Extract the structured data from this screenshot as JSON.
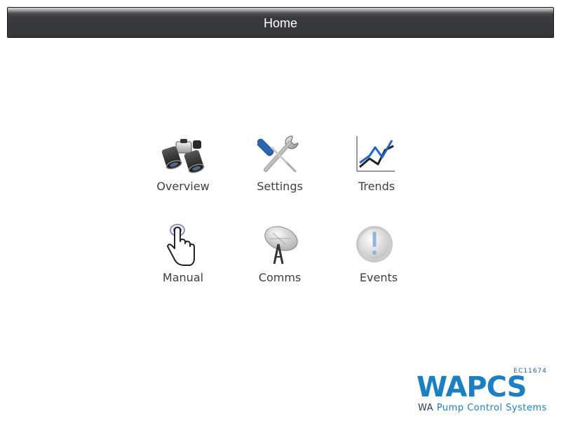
{
  "header": {
    "title": "Home"
  },
  "tiles": [
    {
      "label": "Overview",
      "icon": "binoculars-icon"
    },
    {
      "label": "Settings",
      "icon": "wrench-screwdriver-icon"
    },
    {
      "label": "Trends",
      "icon": "line-chart-icon"
    },
    {
      "label": "Manual",
      "icon": "hand-pointer-icon"
    },
    {
      "label": "Comms",
      "icon": "satellite-dish-icon"
    },
    {
      "label": "Events",
      "icon": "exclamation-icon"
    }
  ],
  "logo": {
    "code": "EC11674",
    "wordmark": "WAPCS",
    "subtitle_prefix": "WA",
    "subtitle": "Pump Control Systems",
    "color": "#1b7fc1"
  },
  "colors": {
    "header_bg": "#383b3e",
    "label_text": "#3f3f3f"
  }
}
